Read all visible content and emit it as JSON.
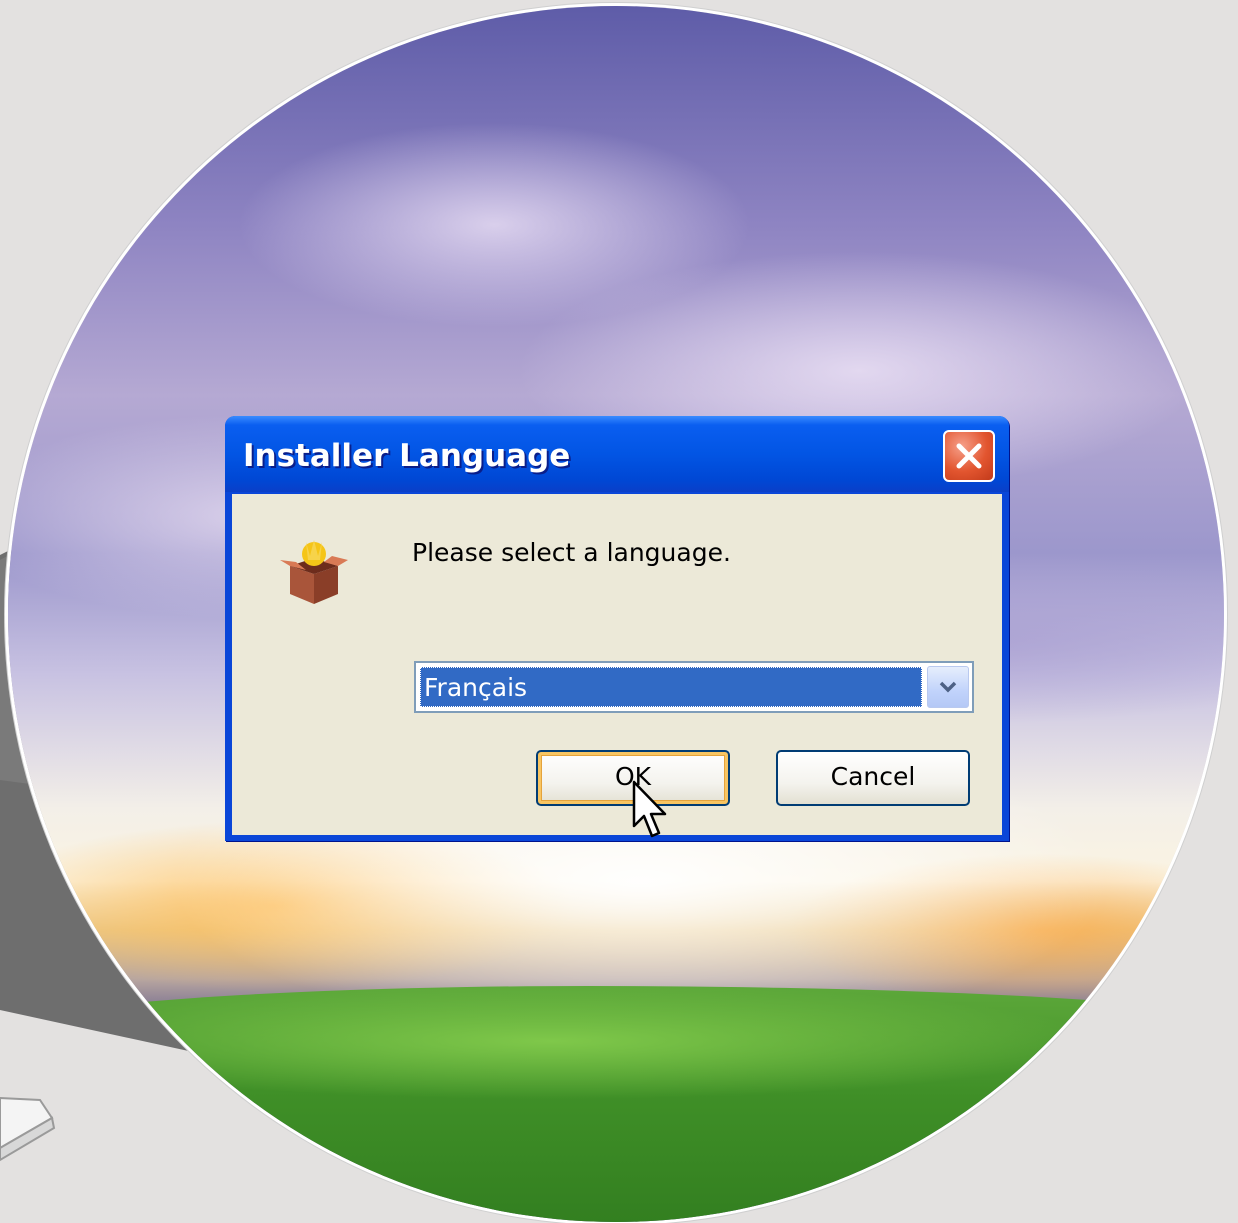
{
  "dialog": {
    "title": "Installer Language",
    "prompt": "Please select a language.",
    "language_select": {
      "selected": "Français"
    },
    "ok_label": "OK",
    "cancel_label": "Cancel"
  },
  "colors": {
    "titlebar_blue": "#0255e4",
    "dialog_face": "#ece9d8",
    "selection_blue": "#316ac5",
    "close_red": "#e2552f",
    "default_button_focus": "#f8c562"
  },
  "icons": [
    "installer-box-icon",
    "close-icon",
    "dropdown-arrow-icon",
    "mouse-pointer-icon"
  ]
}
